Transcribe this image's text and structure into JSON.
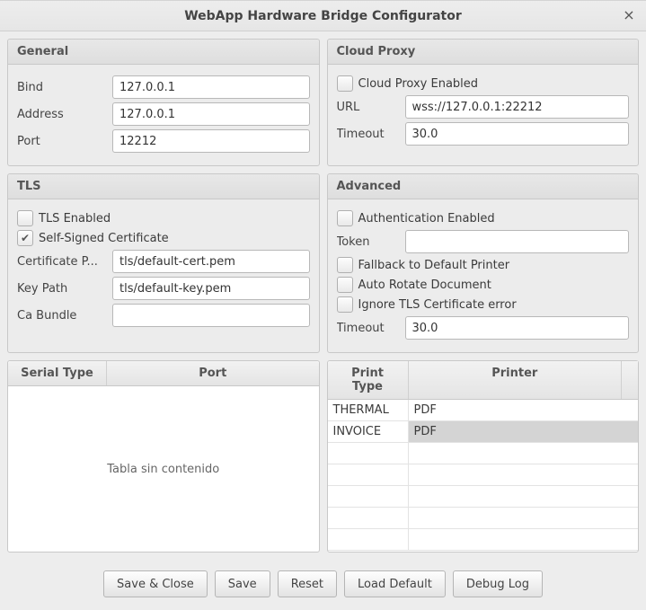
{
  "window": {
    "title": "WebApp Hardware Bridge Configurator"
  },
  "general": {
    "title": "General",
    "bind_label": "Bind",
    "bind_value": "127.0.0.1",
    "address_label": "Address",
    "address_value": "127.0.0.1",
    "port_label": "Port",
    "port_value": "12212"
  },
  "cloud": {
    "title": "Cloud Proxy",
    "enabled_label": "Cloud Proxy Enabled",
    "enabled": false,
    "url_label": "URL",
    "url_value": "wss://127.0.0.1:22212",
    "timeout_label": "Timeout",
    "timeout_value": "30.0"
  },
  "tls": {
    "title": "TLS",
    "enabled_label": "TLS Enabled",
    "enabled": false,
    "selfsigned_label": "Self-Signed Certificate",
    "selfsigned": true,
    "cert_label": "Certificate P...",
    "cert_value": "tls/default-cert.pem",
    "key_label": "Key Path",
    "key_value": "tls/default-key.pem",
    "ca_label": "Ca Bundle",
    "ca_value": ""
  },
  "advanced": {
    "title": "Advanced",
    "auth_label": "Authentication Enabled",
    "auth_enabled": false,
    "token_label": "Token",
    "token_value": "",
    "fallback_label": "Fallback to Default Printer",
    "fallback": false,
    "rotate_label": "Auto Rotate Document",
    "rotate": false,
    "ignoretls_label": "Ignore TLS Certificate error",
    "ignoretls": false,
    "timeout_label": "Timeout",
    "timeout_value": "30.0"
  },
  "serial_table": {
    "col1": "Serial Type",
    "col2": "Port",
    "empty": "Tabla sin contenido"
  },
  "print_table": {
    "col1": "Print Type",
    "col2": "Printer",
    "rows": [
      {
        "type": "THERMAL",
        "printer": "PDF",
        "selected": false
      },
      {
        "type": "INVOICE",
        "printer": "PDF",
        "selected": true
      }
    ]
  },
  "buttons": {
    "save_close": "Save & Close",
    "save": "Save",
    "reset": "Reset",
    "load_default": "Load Default",
    "debug_log": "Debug Log"
  }
}
